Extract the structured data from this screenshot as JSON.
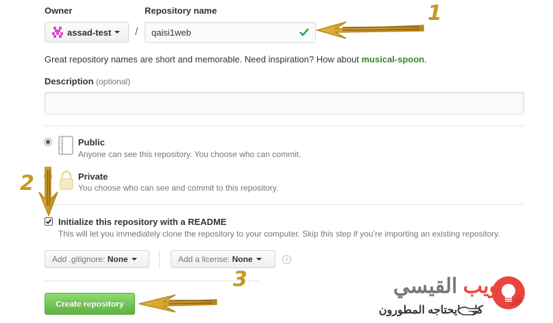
{
  "owner": {
    "label": "Owner",
    "value": "assad-test"
  },
  "repo": {
    "label": "Repository name",
    "value": "qaisi1web",
    "separator": "/"
  },
  "hint": {
    "text": "Great repository names are short and memorable. Need inspiration? How about ",
    "suggestion": "musical-spoon",
    "end": "."
  },
  "description": {
    "label": "Description",
    "optional": "(optional)",
    "value": ""
  },
  "visibility": {
    "public": {
      "title": "Public",
      "desc": "Anyone can see this repository. You choose who can commit.",
      "selected": true
    },
    "private": {
      "title": "Private",
      "desc": "You choose who can see and commit to this repository.",
      "selected": false
    }
  },
  "readme": {
    "title": "Initialize this repository with a README",
    "desc": "This will let you immediately clone the repository to your computer. Skip this step if you’re importing an existing repository.",
    "checked": true
  },
  "gitignore": {
    "label": "Add .gitignore:",
    "value": "None"
  },
  "license": {
    "label": "Add a license:",
    "value": "None"
  },
  "create_button": "Create repository",
  "annotations": {
    "n1": "1",
    "n2": "2",
    "n3": "3"
  },
  "watermark": {
    "brand_part1": "القيسي",
    "brand_part2": "ويب",
    "tagline": "كل مايحتاجه المطورون"
  },
  "colors": {
    "accent_gold": "#c59a1d",
    "green": "#28a745",
    "link_green": "#3a7f2e",
    "red": "#e8453c"
  }
}
